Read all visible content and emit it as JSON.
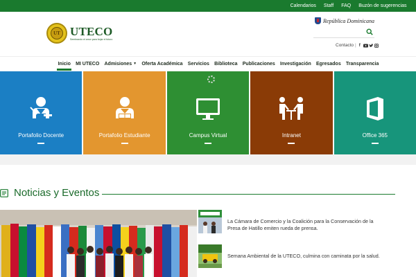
{
  "topbar": {
    "links": [
      "Calendarios",
      "Staff",
      "FAQ",
      "Buzón de sugerencias"
    ]
  },
  "header": {
    "logo_name": "UTECO",
    "logo_seal_text": "UT",
    "logo_tagline": "Sembrando el amor para forjar el futuro",
    "republica": "República Dominicana",
    "search_placeholder": "",
    "contact_label": "Contacto",
    "social_icons": [
      "facebook-icon",
      "youtube-icon",
      "twitter-icon",
      "instagram-icon"
    ]
  },
  "nav": {
    "items": [
      {
        "label": "Inicio",
        "active": true,
        "dropdown": false
      },
      {
        "label": "MI UTECO",
        "active": false,
        "dropdown": false
      },
      {
        "label": "Admisiones",
        "active": false,
        "dropdown": true
      },
      {
        "label": "Oferta Académica",
        "active": false,
        "dropdown": false
      },
      {
        "label": "Servicios",
        "active": false,
        "dropdown": false
      },
      {
        "label": "Biblioteca",
        "active": false,
        "dropdown": false
      },
      {
        "label": "Publicaciones",
        "active": false,
        "dropdown": false
      },
      {
        "label": "Investigación",
        "active": false,
        "dropdown": false
      },
      {
        "label": "Egresados",
        "active": false,
        "dropdown": false
      },
      {
        "label": "Transparencia",
        "active": false,
        "dropdown": false
      }
    ]
  },
  "tiles": [
    {
      "label": "Portafolio Docente",
      "color": "#1b7fc4",
      "icon": "teacher-icon"
    },
    {
      "label": "Portafolio Estudiante",
      "color": "#e3962f",
      "icon": "student-icon"
    },
    {
      "label": "Campus Virtual",
      "color": "#2e8f33",
      "icon": "monitor-icon"
    },
    {
      "label": "Intranet",
      "color": "#8a3b06",
      "icon": "meeting-icon"
    },
    {
      "label": "Office 365",
      "color": "#17957b",
      "icon": "office-icon"
    }
  ],
  "news": {
    "title": "Noticias y Eventos",
    "items": [
      {
        "text": "La Cámara de Comercio y la Coalición para la Conservación de la Presa de Hatillo emiten rueda de prensa."
      },
      {
        "text": "Semana Ambiental de la UTECO, culmina con caminata por la salud."
      }
    ]
  },
  "colors": {
    "brand_green": "#1a7a2e",
    "topbar": "#1a7a2e"
  }
}
